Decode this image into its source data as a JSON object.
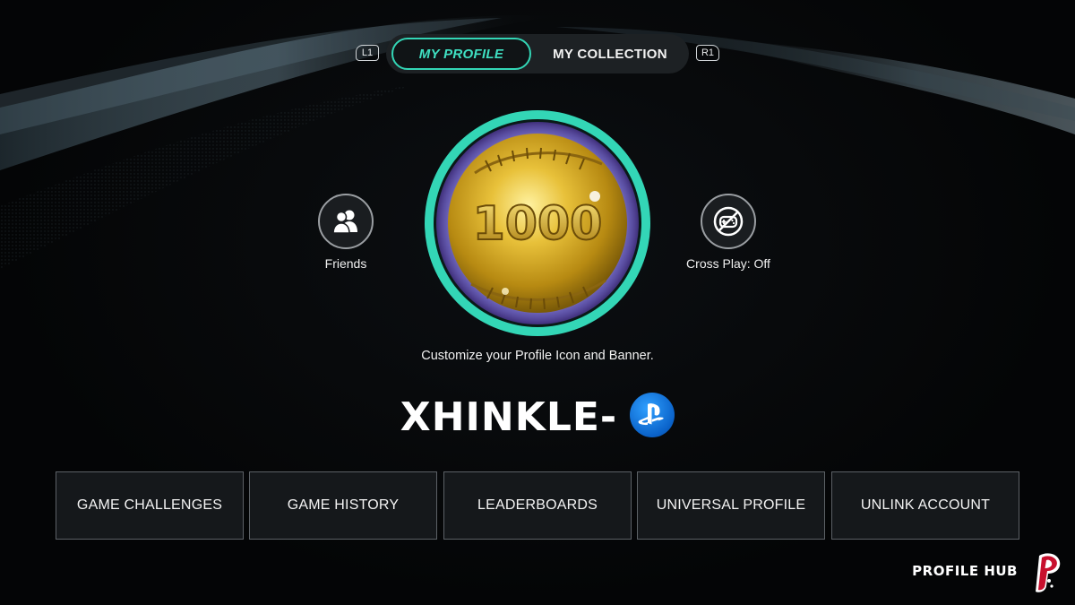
{
  "tabs": {
    "left_bumper": "L1",
    "right_bumper": "R1",
    "items": [
      {
        "label": "MY PROFILE",
        "active": true
      },
      {
        "label": "MY COLLECTION",
        "active": false
      }
    ]
  },
  "friends": {
    "label": "Friends",
    "icon": "friends-icon"
  },
  "cross_play": {
    "label": "Cross Play: Off",
    "icon": "cross-play-off-icon"
  },
  "badge": {
    "text": "1000",
    "ring_color": "#33d6b6"
  },
  "customize_text": "Customize your Profile Icon and Banner.",
  "username": "XHINKLE-",
  "platform_icon": "playstation-icon",
  "menu": [
    {
      "label": "GAME CHALLENGES"
    },
    {
      "label": "GAME HISTORY"
    },
    {
      "label": "LEADERBOARDS"
    },
    {
      "label": "UNIVERSAL PROFILE"
    },
    {
      "label": "UNLINK ACCOUNT"
    }
  ],
  "footer": {
    "title": "PROFILE HUB",
    "logo": "team-logo"
  },
  "colors": {
    "accent": "#33d6b6",
    "background": "#050608",
    "button_bg": "#15181b"
  }
}
